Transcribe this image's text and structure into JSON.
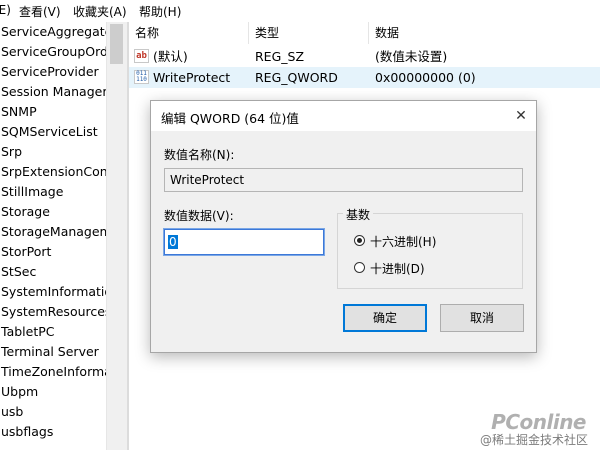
{
  "menubar": {
    "items": [
      "(E)",
      "查看(V)",
      "收藏夹(A)",
      "帮助(H)"
    ]
  },
  "tree": {
    "items": [
      "ServiceAggregate",
      "ServiceGroupOrde",
      "ServiceProvider",
      "Session Manager",
      "SNMP",
      "SQMServiceList",
      "Srp",
      "SrpExtensionConfi",
      "StillImage",
      "Storage",
      "StorageManagem",
      "StorPort",
      "StSec",
      "SystemInformatio",
      "SystemResources",
      "TabletPC",
      "Terminal Server",
      "TimeZoneInforma",
      "Ubpm",
      "usb",
      "usbflags"
    ]
  },
  "list": {
    "columns": [
      "名称",
      "类型",
      "数据"
    ],
    "rows": [
      {
        "icon": "string-value-icon",
        "icon_text": "ab",
        "name": "(默认)",
        "type": "REG_SZ",
        "data": "(数值未设置)"
      },
      {
        "icon": "binary-value-icon",
        "icon_text": "011 110",
        "name": "WriteProtect",
        "type": "REG_QWORD",
        "data": "0x00000000 (0)"
      }
    ]
  },
  "dialog": {
    "title": "编辑 QWORD (64 位)值",
    "close_glyph": "✕",
    "value_name_label": "数值名称(N):",
    "value_name": "WriteProtect",
    "value_data_label": "数值数据(V):",
    "value_data": "0",
    "base_label": "基数",
    "radio_hex": "十六进制(H)",
    "radio_dec": "十进制(D)",
    "selected_base": "hex",
    "ok_label": "确定",
    "cancel_label": "取消"
  },
  "watermark": {
    "brand": "PConline",
    "caption": "@稀土掘金技术社区"
  },
  "colors": {
    "selection": "#e5f3fb",
    "accent": "#0078d7",
    "dialog_bg": "#f0f0f0"
  }
}
